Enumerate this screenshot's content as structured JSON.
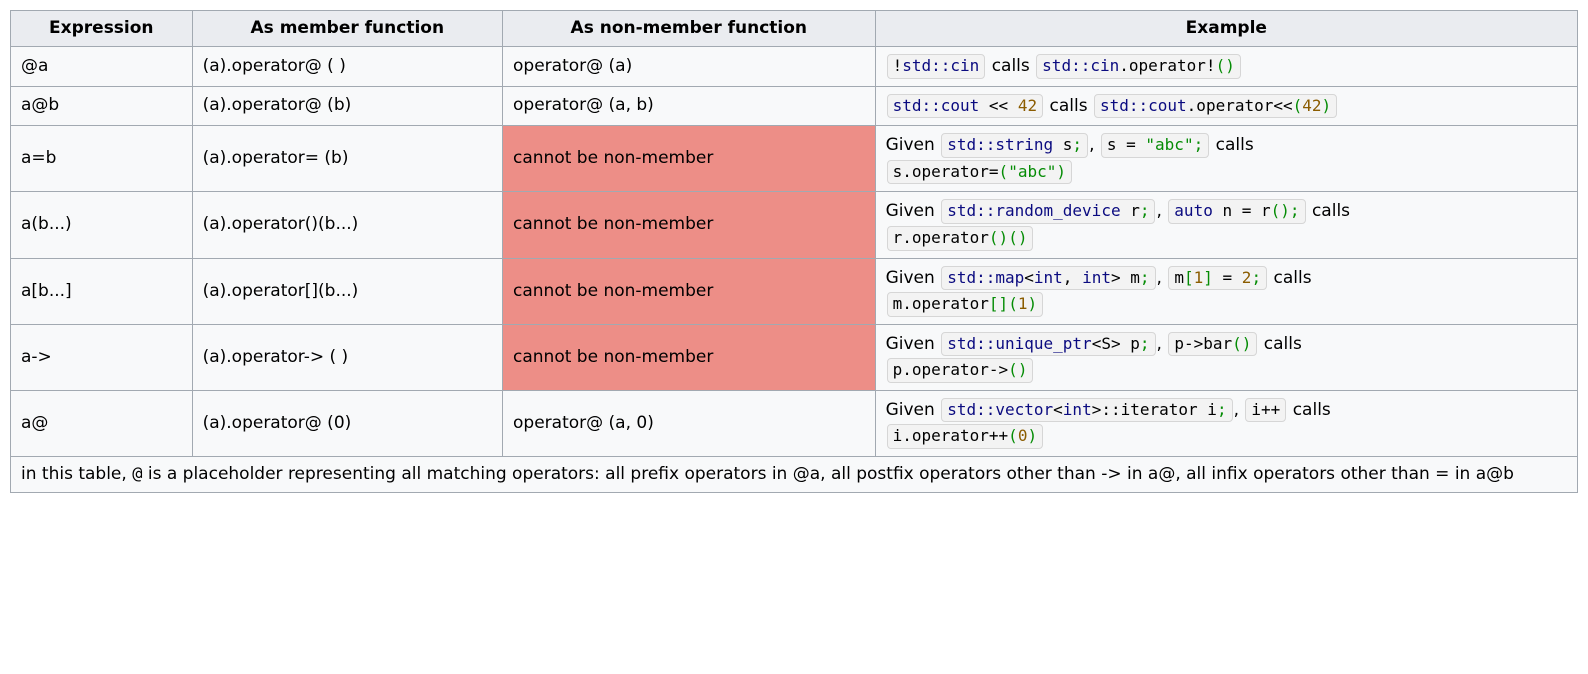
{
  "columns": {
    "c0": "Expression",
    "c1": "As member function",
    "c2": "As non-member function",
    "c3": "Example"
  },
  "nonmember_no": "cannot be non-member",
  "connectors": {
    "calls": "calls",
    "given": "Given",
    "comma": ","
  },
  "rows": {
    "r1": {
      "expr": "@a",
      "member": "(a).operator@ ( )",
      "nonmember": "operator@ (a)",
      "ex": {
        "chip1": [
          {
            "t": "!",
            "c": "t-plain"
          },
          {
            "t": "std::cin",
            "c": "t-link"
          }
        ],
        "chip2": [
          {
            "t": "std::cin",
            "c": "t-link"
          },
          {
            "t": ".operator!",
            "c": "t-plain"
          },
          {
            "t": "(",
            "c": "t-paren"
          },
          {
            "t": ")",
            "c": "t-paren"
          }
        ]
      }
    },
    "r2": {
      "expr": "a@b",
      "member": "(a).operator@ (b)",
      "nonmember": "operator@ (a, b)",
      "ex": {
        "chip1": [
          {
            "t": "std::cout",
            "c": "t-link"
          },
          {
            "t": " << ",
            "c": "t-plain"
          },
          {
            "t": "42",
            "c": "t-num"
          }
        ],
        "chip2": [
          {
            "t": "std::cout",
            "c": "t-link"
          },
          {
            "t": ".operator<<",
            "c": "t-plain"
          },
          {
            "t": "(",
            "c": "t-paren"
          },
          {
            "t": "42",
            "c": "t-num"
          },
          {
            "t": ")",
            "c": "t-paren"
          }
        ]
      }
    },
    "r3": {
      "expr": "a=b",
      "member": "(a).operator= (b)",
      "ex": {
        "given": [
          {
            "t": "std::string",
            "c": "t-link"
          },
          {
            "t": " s",
            "c": "t-plain"
          },
          {
            "t": ";",
            "c": "t-semi"
          }
        ],
        "chip1": [
          {
            "t": "s = ",
            "c": "t-plain"
          },
          {
            "t": "\"abc\"",
            "c": "t-str"
          },
          {
            "t": ";",
            "c": "t-semi"
          }
        ],
        "chip2": [
          {
            "t": "s.operator=",
            "c": "t-plain"
          },
          {
            "t": "(",
            "c": "t-paren"
          },
          {
            "t": "\"abc\"",
            "c": "t-str"
          },
          {
            "t": ")",
            "c": "t-paren"
          }
        ]
      }
    },
    "r4": {
      "expr": "a(b...)",
      "member": "(a).operator()(b...)",
      "ex": {
        "given": [
          {
            "t": "std::random_device",
            "c": "t-link"
          },
          {
            "t": " r",
            "c": "t-plain"
          },
          {
            "t": ";",
            "c": "t-semi"
          }
        ],
        "chip1": [
          {
            "t": "auto",
            "c": "t-kw"
          },
          {
            "t": " n = r",
            "c": "t-plain"
          },
          {
            "t": "(",
            "c": "t-paren"
          },
          {
            "t": ")",
            "c": "t-paren"
          },
          {
            "t": ";",
            "c": "t-semi"
          }
        ],
        "chip2": [
          {
            "t": "r.operator",
            "c": "t-plain"
          },
          {
            "t": "(",
            "c": "t-paren"
          },
          {
            "t": ")",
            "c": "t-paren"
          },
          {
            "t": "(",
            "c": "t-paren"
          },
          {
            "t": ")",
            "c": "t-paren"
          }
        ]
      }
    },
    "r5": {
      "expr": "a[b...]",
      "member": "(a).operator[](b...)",
      "ex": {
        "given": [
          {
            "t": "std::map",
            "c": "t-link"
          },
          {
            "t": "<",
            "c": "t-plain"
          },
          {
            "t": "int",
            "c": "t-kw"
          },
          {
            "t": ", ",
            "c": "t-plain"
          },
          {
            "t": "int",
            "c": "t-kw"
          },
          {
            "t": "> m",
            "c": "t-plain"
          },
          {
            "t": ";",
            "c": "t-semi"
          }
        ],
        "chip1": [
          {
            "t": "m",
            "c": "t-plain"
          },
          {
            "t": "[",
            "c": "t-brack"
          },
          {
            "t": "1",
            "c": "t-num"
          },
          {
            "t": "]",
            "c": "t-brack"
          },
          {
            "t": " = ",
            "c": "t-plain"
          },
          {
            "t": "2",
            "c": "t-num"
          },
          {
            "t": ";",
            "c": "t-semi"
          }
        ],
        "chip2": [
          {
            "t": "m.operator",
            "c": "t-plain"
          },
          {
            "t": "[",
            "c": "t-brack"
          },
          {
            "t": "]",
            "c": "t-brack"
          },
          {
            "t": "(",
            "c": "t-paren"
          },
          {
            "t": "1",
            "c": "t-num"
          },
          {
            "t": ")",
            "c": "t-paren"
          }
        ]
      }
    },
    "r6": {
      "expr": "a->",
      "member": "(a).operator-> ( )",
      "ex": {
        "given": [
          {
            "t": "std::unique_ptr",
            "c": "t-link"
          },
          {
            "t": "<S> p",
            "c": "t-plain"
          },
          {
            "t": ";",
            "c": "t-semi"
          }
        ],
        "chip1": [
          {
            "t": "p->bar",
            "c": "t-plain"
          },
          {
            "t": "(",
            "c": "t-paren"
          },
          {
            "t": ")",
            "c": "t-paren"
          }
        ],
        "chip2": [
          {
            "t": "p.operator->",
            "c": "t-plain"
          },
          {
            "t": "(",
            "c": "t-paren"
          },
          {
            "t": ")",
            "c": "t-paren"
          }
        ]
      }
    },
    "r7": {
      "expr": "a@",
      "member": "(a).operator@ (0)",
      "nonmember": "operator@ (a, 0)",
      "ex": {
        "given": [
          {
            "t": "std::vector",
            "c": "t-link"
          },
          {
            "t": "<",
            "c": "t-plain"
          },
          {
            "t": "int",
            "c": "t-kw"
          },
          {
            "t": ">::",
            "c": "t-plain"
          },
          {
            "t": "iterator i",
            "c": "t-plain"
          },
          {
            "t": ";",
            "c": "t-semi"
          }
        ],
        "chip1": [
          {
            "t": "i++",
            "c": "t-plain"
          }
        ],
        "chip2": [
          {
            "t": "i.operator++",
            "c": "t-plain"
          },
          {
            "t": "(",
            "c": "t-paren"
          },
          {
            "t": "0",
            "c": "t-num"
          },
          {
            "t": ")",
            "c": "t-paren"
          }
        ]
      }
    }
  },
  "footnote": {
    "pre": "in this table, ",
    "at": "@",
    "post": " is a placeholder representing all matching operators: all prefix operators in @a, all postfix operators other than -> in a@, all infix operators other than = in a@b"
  }
}
